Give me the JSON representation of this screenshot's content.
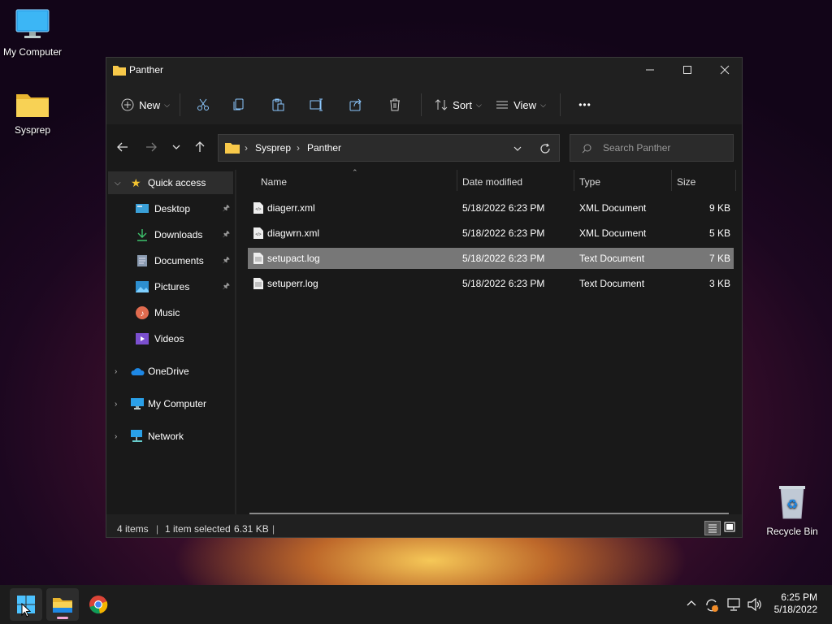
{
  "desktop": {
    "icons": [
      {
        "label": "My Computer"
      },
      {
        "label": "Sysprep"
      },
      {
        "label": "Recycle Bin"
      }
    ]
  },
  "window": {
    "title": "Panther",
    "toolbar": {
      "new_label": "New",
      "sort_label": "Sort",
      "view_label": "View",
      "more_label": "•••"
    },
    "address": {
      "crumbs": [
        "Sysprep",
        "Panther"
      ],
      "search_placeholder": "Search Panther"
    },
    "sidebar": {
      "quick_access": "Quick access",
      "items": [
        {
          "label": "Desktop",
          "pinned": true
        },
        {
          "label": "Downloads",
          "pinned": true
        },
        {
          "label": "Documents",
          "pinned": true
        },
        {
          "label": "Pictures",
          "pinned": true
        },
        {
          "label": "Music",
          "pinned": false
        },
        {
          "label": "Videos",
          "pinned": false
        }
      ],
      "roots": [
        {
          "label": "OneDrive"
        },
        {
          "label": "My Computer"
        },
        {
          "label": "Network"
        }
      ]
    },
    "columns": {
      "name": "Name",
      "date": "Date modified",
      "type": "Type",
      "size": "Size"
    },
    "files": [
      {
        "name": "diagerr.xml",
        "date": "5/18/2022 6:23 PM",
        "type": "XML Document",
        "size": "9 KB",
        "selected": false
      },
      {
        "name": "diagwrn.xml",
        "date": "5/18/2022 6:23 PM",
        "type": "XML Document",
        "size": "5 KB",
        "selected": false
      },
      {
        "name": "setupact.log",
        "date": "5/18/2022 6:23 PM",
        "type": "Text Document",
        "size": "7 KB",
        "selected": true
      },
      {
        "name": "setuperr.log",
        "date": "5/18/2022 6:23 PM",
        "type": "Text Document",
        "size": "3 KB",
        "selected": false
      }
    ],
    "status": {
      "count": "4 items",
      "selection": "1 item selected",
      "size": "6.31 KB"
    }
  },
  "taskbar": {
    "clock_time": "6:25 PM",
    "clock_date": "5/18/2022"
  },
  "colors": {
    "accent": "#60cdff",
    "folder": "#f8c94a",
    "selected_row": "#777777"
  }
}
